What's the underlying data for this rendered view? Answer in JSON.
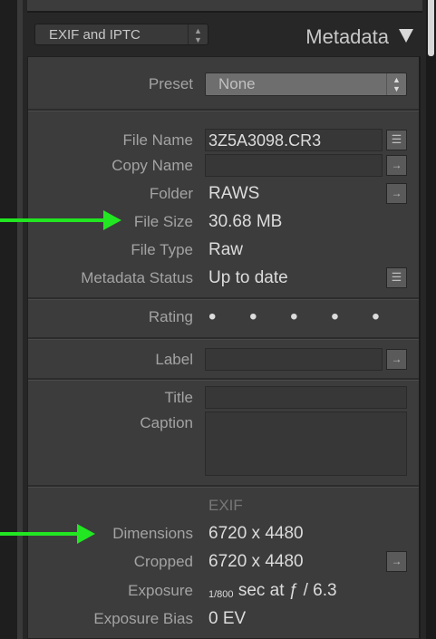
{
  "header": {
    "dropdown_value": "EXIF and IPTC",
    "title": "Metadata"
  },
  "preset": {
    "label": "Preset",
    "value": "None"
  },
  "fields": {
    "file_name": {
      "label": "File Name",
      "value": "3Z5A3098.CR3"
    },
    "copy_name": {
      "label": "Copy Name",
      "value": ""
    },
    "folder": {
      "label": "Folder",
      "value": "RAWS"
    },
    "file_size": {
      "label": "File Size",
      "value": "30.68 MB"
    },
    "file_type": {
      "label": "File Type",
      "value": "Raw"
    },
    "metadata_status": {
      "label": "Metadata Status",
      "value": "Up to date"
    },
    "rating": {
      "label": "Rating",
      "value": "• • • • •"
    },
    "label": {
      "label": "Label",
      "value": ""
    },
    "title": {
      "label": "Title",
      "value": ""
    },
    "caption": {
      "label": "Caption",
      "value": ""
    }
  },
  "exif": {
    "section_label": "EXIF",
    "dimensions": {
      "label": "Dimensions",
      "value": "6720 x 4480"
    },
    "cropped": {
      "label": "Cropped",
      "value": "6720 x 4480"
    },
    "exposure": {
      "label": "Exposure",
      "fraction": "1/800",
      "value": "sec at ƒ / 6.3"
    },
    "exposure_bias": {
      "label": "Exposure Bias",
      "value": "0 EV"
    }
  },
  "annotations": {
    "arrow_color": "#22e622"
  }
}
